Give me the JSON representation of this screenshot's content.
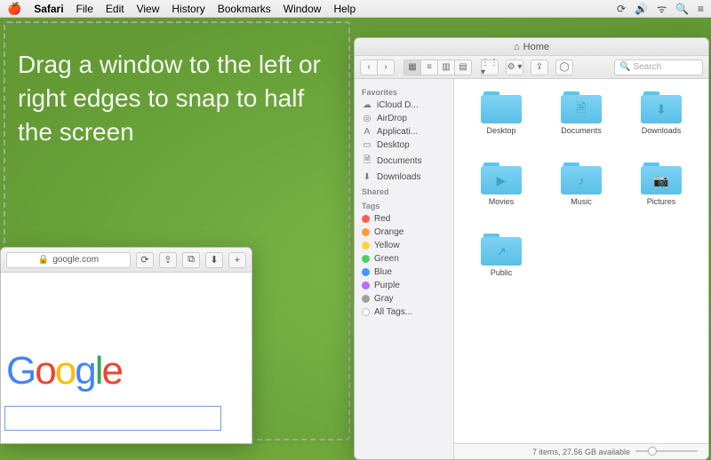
{
  "menubar": {
    "app": "Safari",
    "items": [
      "File",
      "Edit",
      "View",
      "History",
      "Bookmarks",
      "Window",
      "Help"
    ]
  },
  "instruction": "Drag a window to the left or right edges to snap to half the screen",
  "safari": {
    "url": "google.com",
    "lock_glyph": "🔒"
  },
  "finder": {
    "title": "Home",
    "home_glyph": "⌂",
    "search_placeholder": "Search",
    "sidebar": {
      "favorites_heading": "Favorites",
      "favorites": [
        {
          "icon": "☁︎",
          "label": "iCloud D..."
        },
        {
          "icon": "◎",
          "label": "AirDrop"
        },
        {
          "icon": "A",
          "label": "Applicati..."
        },
        {
          "icon": "▭",
          "label": "Desktop"
        },
        {
          "icon": "🗎",
          "label": "Documents"
        },
        {
          "icon": "⬇",
          "label": "Downloads"
        }
      ],
      "shared_heading": "Shared",
      "tags_heading": "Tags",
      "tags": [
        {
          "color": "#ff5a52",
          "label": "Red"
        },
        {
          "color": "#ff9a3c",
          "label": "Orange"
        },
        {
          "color": "#ffd23c",
          "label": "Yellow"
        },
        {
          "color": "#4fd062",
          "label": "Green"
        },
        {
          "color": "#3d9cff",
          "label": "Blue"
        },
        {
          "color": "#b86bff",
          "label": "Purple"
        },
        {
          "color": "#9f9f9f",
          "label": "Gray"
        }
      ],
      "all_tags": "All Tags..."
    },
    "folders": [
      {
        "label": "Desktop",
        "glyph": ""
      },
      {
        "label": "Documents",
        "glyph": "🗎"
      },
      {
        "label": "Downloads",
        "glyph": "⬇"
      },
      {
        "label": "Movies",
        "glyph": "▶"
      },
      {
        "label": "Music",
        "glyph": "♪"
      },
      {
        "label": "Pictures",
        "glyph": "📷"
      },
      {
        "label": "Public",
        "glyph": "↗"
      }
    ],
    "status": "7 items, 27.56 GB available"
  }
}
